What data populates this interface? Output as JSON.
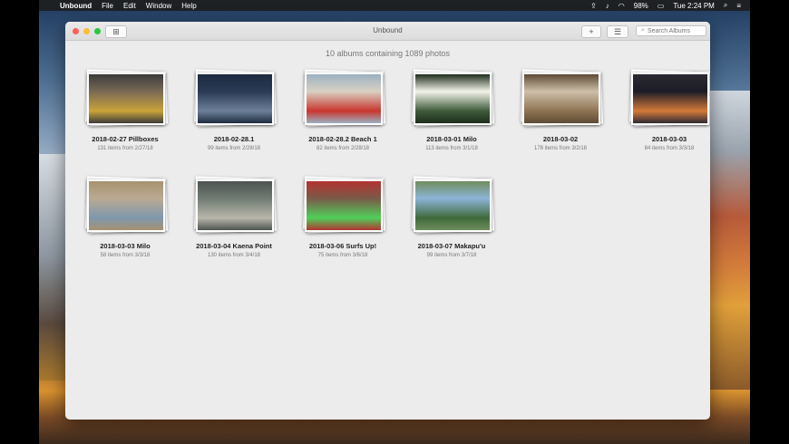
{
  "menubar": {
    "app_name": "Unbound",
    "menus": [
      "File",
      "Edit",
      "Window",
      "Help"
    ],
    "battery": "98%",
    "clock": "Tue 2:24 PM"
  },
  "window": {
    "title": "Unbound",
    "search_placeholder": "Search Albums",
    "summary": "10 albums containing 1089 photos"
  },
  "albums": [
    {
      "name": "2018-02-27 Pillboxes",
      "meta": "131 items from 2/27/18",
      "colors": [
        "#7a6a55",
        "#c9a43a",
        "#3b3b3b"
      ]
    },
    {
      "name": "2018-02-28.1",
      "meta": "99 items from 2/28/18",
      "colors": [
        "#2a3a55",
        "#6d8099",
        "#1d2b3f"
      ]
    },
    {
      "name": "2018-02-28.2 Beach 1",
      "meta": "82 items from 2/28/18",
      "colors": [
        "#d9d1c3",
        "#c8362e",
        "#9bb1c2"
      ]
    },
    {
      "name": "2018-03-01 Milo",
      "meta": "113 items from 3/1/18",
      "colors": [
        "#f3f3ea",
        "#3e5b3a",
        "#1f2e1d"
      ]
    },
    {
      "name": "2018-03-02",
      "meta": "178 items from 3/2/18",
      "colors": [
        "#cdbfa8",
        "#8e7352",
        "#5e4a36"
      ]
    },
    {
      "name": "2018-03-03",
      "meta": "84 items from 3/3/18",
      "colors": [
        "#1b1c26",
        "#d57a3a",
        "#2b2a33"
      ]
    },
    {
      "name": "2018-03-03 Milo",
      "meta": "58 items from 3/3/18",
      "colors": [
        "#b9aa92",
        "#7f97ad",
        "#a7926f"
      ]
    },
    {
      "name": "2018-03-04 Kaena Point",
      "meta": "130 items from 3/4/18",
      "colors": [
        "#6f7b73",
        "#b9b6aa",
        "#4d5450"
      ]
    },
    {
      "name": "2018-03-06 Surfs Up!",
      "meta": "75 items from 3/6/18",
      "colors": [
        "#7a5a48",
        "#4fcf5a",
        "#b23430"
      ]
    },
    {
      "name": "2018-03-07 Makapu'u",
      "meta": "99 items from 3/7/18",
      "colors": [
        "#8db4d8",
        "#3f6a3b",
        "#6f8d5d"
      ]
    }
  ]
}
